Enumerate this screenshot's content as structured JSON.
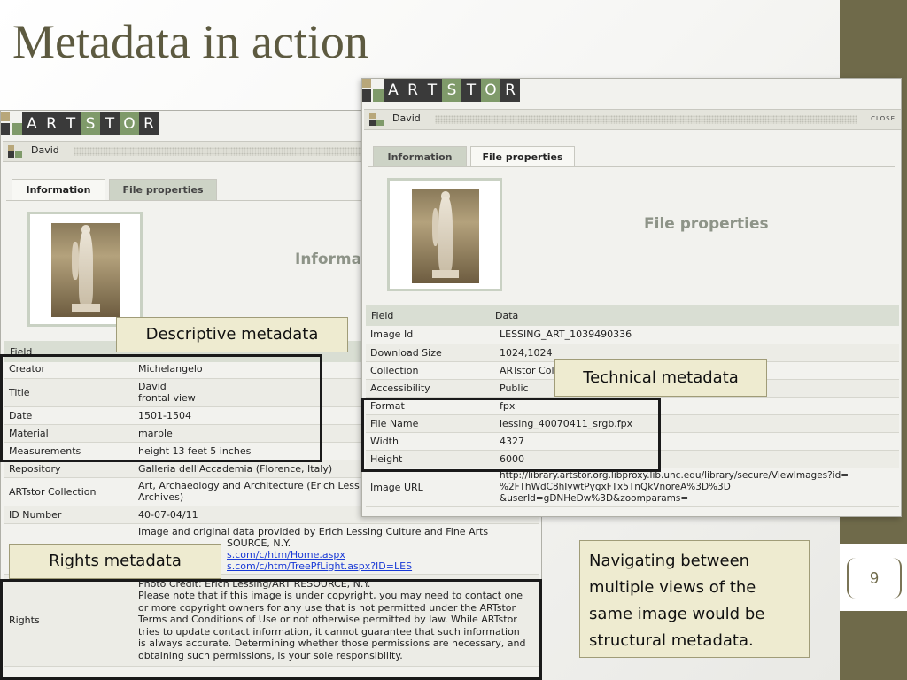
{
  "slide": {
    "title": "Metadata in action",
    "page_number": "9",
    "note": "Navigating between multiple views of the same image would be structural metadata."
  },
  "labels": {
    "descriptive": "Descriptive metadata",
    "technical": "Technical metadata",
    "rights": "Rights metadata"
  },
  "logo_letters": [
    "A",
    "R",
    "T",
    "S",
    "T",
    "O",
    "R"
  ],
  "colors": {
    "accent": "#6f6a4a",
    "logo_dark": "#3a3a3a",
    "logo_green": "#7f9a6a",
    "logo_tan": "#b8a77a",
    "label_bg": "#eeebd0"
  },
  "left_window": {
    "title": "David",
    "tabs": [
      {
        "label": "Information",
        "active": true
      },
      {
        "label": "File properties",
        "active": false
      }
    ],
    "heading": "Informa",
    "field_header": "Field",
    "rows": [
      {
        "field": "Creator",
        "value": "Michelangelo"
      },
      {
        "field": "Title",
        "value": "David\nfrontal view"
      },
      {
        "field": "Date",
        "value": "1501-1504"
      },
      {
        "field": "Material",
        "value": "marble"
      },
      {
        "field": "Measurements",
        "value": "height 13 feet 5 inches"
      },
      {
        "field": "Repository",
        "value": "Galleria dell'Accademia (Florence, Italy)"
      },
      {
        "field": "ARTstor Collection",
        "value": "Art, Archaeology and Architecture (Erich Less\nArchives)"
      },
      {
        "field": "ID Number",
        "value": "40-07-04/11"
      }
    ],
    "source_text": {
      "line1": "Image and original data provided by Erich Lessing Culture and Fine Arts",
      "line2": "SOURCE, N.Y.",
      "link1": "s.com/c/htm/Home.aspx",
      "link2": "s.com/c/htm/TreePfLight.aspx?ID=LES"
    },
    "rights": {
      "field": "Rights",
      "lines": [
        "Photo Credit: Erich Lessing/ART RESOURCE, N.Y.",
        "Please note that if this image is under copyright, you may need to contact one",
        "or more copyright owners for any use that is not permitted under the ARTstor",
        "Terms and Conditions of Use or not otherwise permitted by law. While ARTstor",
        "tries to update contact information, it cannot guarantee that such information",
        "is always accurate. Determining whether those permissions are necessary, and",
        "obtaining such permissions, is your sole responsibility."
      ]
    }
  },
  "right_window": {
    "title": "David",
    "close_label": "CLOSE",
    "tabs": [
      {
        "label": "Information",
        "active": false
      },
      {
        "label": "File properties",
        "active": true
      }
    ],
    "heading": "File properties",
    "col_field": "Field",
    "col_data": "Data",
    "rows": [
      {
        "field": "Image Id",
        "value": "LESSING_ART_1039490336"
      },
      {
        "field": "Download Size",
        "value": "1024,1024"
      },
      {
        "field": "Collection",
        "value": "ARTstor Colle"
      },
      {
        "field": "Accessibility",
        "value": "Public"
      },
      {
        "field": "Format",
        "value": "fpx"
      },
      {
        "field": "File Name",
        "value": "lessing_40070411_srgb.fpx"
      },
      {
        "field": "Width",
        "value": "4327"
      },
      {
        "field": "Height",
        "value": "6000"
      },
      {
        "field": "Image URL",
        "value": "http://library.artstor.org.libproxy.lib.unc.edu/library/secure/ViewImages?id=\n%2FThWdC8hIywtPygxFTx5TnQkVnoreA%3D%3D\n&userId=gDNHeDw%3D&zoomparams="
      }
    ]
  }
}
